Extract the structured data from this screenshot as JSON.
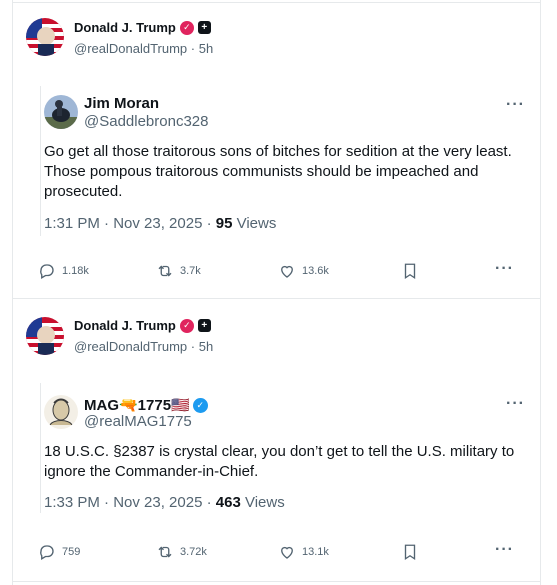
{
  "posts": [
    {
      "author_name": "Donald J. Trump",
      "handle": "@realDonaldTrump",
      "time": "5h",
      "quote": {
        "name": "Jim Moran",
        "handle": "@Saddlebronc328",
        "text": "Go get all those traitorous sons of bitches for sedition at the very least.  Those pompous traitorous communists should be impeached and prosecuted.",
        "timestamp": "1:31 PM · Nov 23, 2025 · ",
        "views_count": "95",
        "views_label": " Views"
      },
      "actions": {
        "replies": "1.18k",
        "reposts": "3.7k",
        "likes": "13.6k"
      }
    },
    {
      "author_name": "Donald J. Trump",
      "handle": "@realDonaldTrump",
      "time": "5h",
      "quote": {
        "name": "MAG🔫1775🇺🇸",
        "handle": "@realMAG1775",
        "text": "18 U.S.C. §2387 is crystal clear, you don’t get to tell the U.S. military to ignore the Commander-in-Chief.",
        "timestamp": "1:33 PM · Nov 23, 2025 · ",
        "views_count": "463",
        "views_label": " Views"
      },
      "actions": {
        "replies": "759",
        "reposts": "3.72k",
        "likes": "13.1k"
      }
    }
  ],
  "colors": {
    "text": "#0f1419",
    "muted": "#536471",
    "verified_pink": "#e0245e",
    "verified_blue": "#1d9bf0",
    "border": "#e6e9eb"
  },
  "icons": [
    "reply-icon",
    "repost-icon",
    "like-icon",
    "bookmark-icon",
    "more-icon",
    "verified-badge-icon"
  ]
}
